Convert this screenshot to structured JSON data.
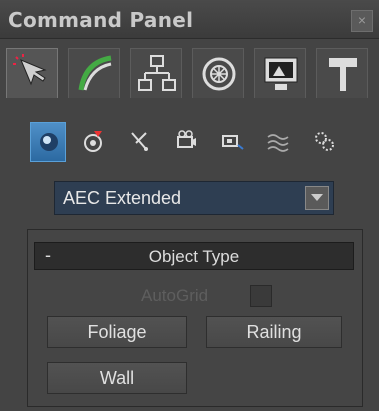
{
  "titlebar": {
    "title": "Command Panel",
    "close_glyph": "×"
  },
  "tabs": [
    {
      "name": "create",
      "icon": "create-cursor-icon",
      "active": true
    },
    {
      "name": "modify",
      "icon": "modify-arc-icon",
      "active": false
    },
    {
      "name": "hierarchy",
      "icon": "hierarchy-icon",
      "active": false
    },
    {
      "name": "motion",
      "icon": "motion-icon",
      "active": false
    },
    {
      "name": "display",
      "icon": "display-icon",
      "active": false
    },
    {
      "name": "utilities",
      "icon": "hammer-icon",
      "active": false
    }
  ],
  "categories": [
    {
      "name": "geometry",
      "icon": "sphere-icon",
      "active": true
    },
    {
      "name": "shapes",
      "icon": "shapes-icon",
      "active": false
    },
    {
      "name": "lights",
      "icon": "light-icon",
      "active": false
    },
    {
      "name": "cameras",
      "icon": "camera-icon",
      "active": false
    },
    {
      "name": "helpers",
      "icon": "helper-icon",
      "active": false
    },
    {
      "name": "spacewarps",
      "icon": "spacewarp-icon",
      "active": false
    },
    {
      "name": "systems",
      "icon": "systems-gear-icon",
      "active": false
    }
  ],
  "dropdown": {
    "value": "AEC Extended"
  },
  "rollout": {
    "collapse_glyph": "-",
    "title": "Object Type",
    "autogrid_label": "AutoGrid",
    "buttons": {
      "foliage": "Foliage",
      "railing": "Railing",
      "wall": "Wall"
    }
  },
  "colors": {
    "accent": "#3f82c0",
    "dropdown_bg": "#2e3e52",
    "panel_bg": "#444444"
  }
}
